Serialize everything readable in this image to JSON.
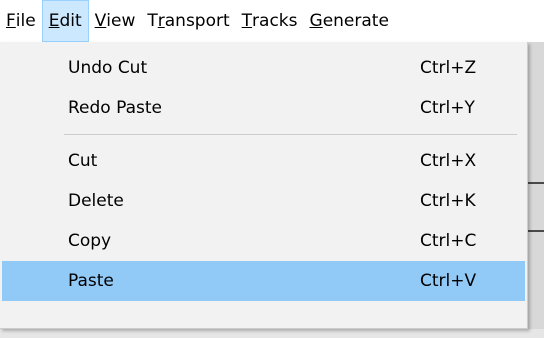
{
  "menubar": {
    "items": [
      {
        "prefix": "",
        "mnemonic": "F",
        "rest": "ile"
      },
      {
        "prefix": "",
        "mnemonic": "E",
        "rest": "dit"
      },
      {
        "prefix": "",
        "mnemonic": "V",
        "rest": "iew"
      },
      {
        "prefix": "T",
        "mnemonic": "r",
        "rest": "ansport"
      },
      {
        "prefix": "",
        "mnemonic": "T",
        "rest": "racks"
      },
      {
        "prefix": "",
        "mnemonic": "G",
        "rest": "enerate"
      }
    ]
  },
  "edit_menu": {
    "group1": [
      {
        "label": "Undo Cut",
        "shortcut": "Ctrl+Z"
      },
      {
        "label": "Redo Paste",
        "shortcut": "Ctrl+Y"
      }
    ],
    "group2": [
      {
        "label": "Cut",
        "shortcut": "Ctrl+X"
      },
      {
        "label": "Delete",
        "shortcut": "Ctrl+K"
      },
      {
        "label": "Copy",
        "shortcut": "Ctrl+C"
      },
      {
        "label": "Paste",
        "shortcut": "Ctrl+V"
      }
    ]
  },
  "colors": {
    "open_menu_bg": "#cce8ff",
    "highlight_bg": "#91c9f7",
    "dropdown_bg": "#f2f2f2"
  }
}
